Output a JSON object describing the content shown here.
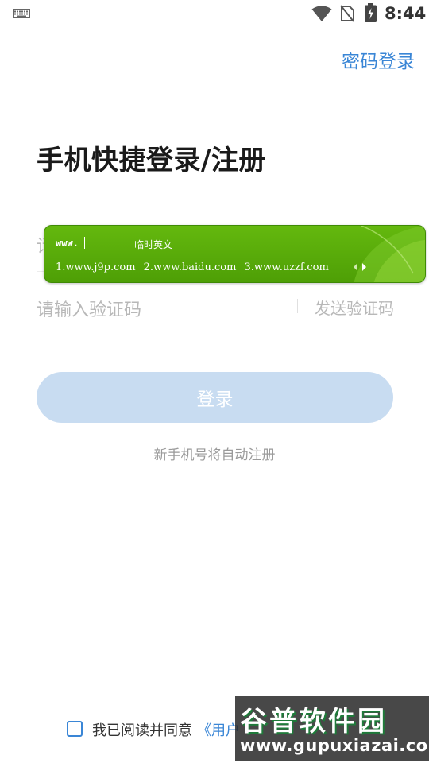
{
  "status_bar": {
    "time": "8:44",
    "icons": [
      "keyboard-icon",
      "wifi-icon",
      "no-sim-icon",
      "battery-charging-icon"
    ]
  },
  "header": {
    "password_login_link": "密码登录"
  },
  "main": {
    "title": "手机快捷登录/注册",
    "phone_input": {
      "placeholder": "请输入手机号",
      "value": ""
    },
    "code_input": {
      "placeholder": "请输入验证码",
      "value": ""
    },
    "send_code_label": "发送验证码",
    "login_button_label": "登录",
    "auto_register_hint": "新手机号将自动注册"
  },
  "ime": {
    "composition": "www.",
    "mode_label": "临时英文",
    "candidates": [
      "1.www.j9p.com",
      "2.www.baidu.com",
      "3.www.uzzf.com"
    ]
  },
  "agreement": {
    "checked": false,
    "text": "我已阅读并同意",
    "link_text": "《用户"
  },
  "watermark": {
    "logo_text": "谷普软件园",
    "url": "www.gupuxiazai.com"
  },
  "colors": {
    "accent": "#3a86d6",
    "login_button_disabled": "#c8dcf1",
    "ime_green": "#5aad0a"
  }
}
